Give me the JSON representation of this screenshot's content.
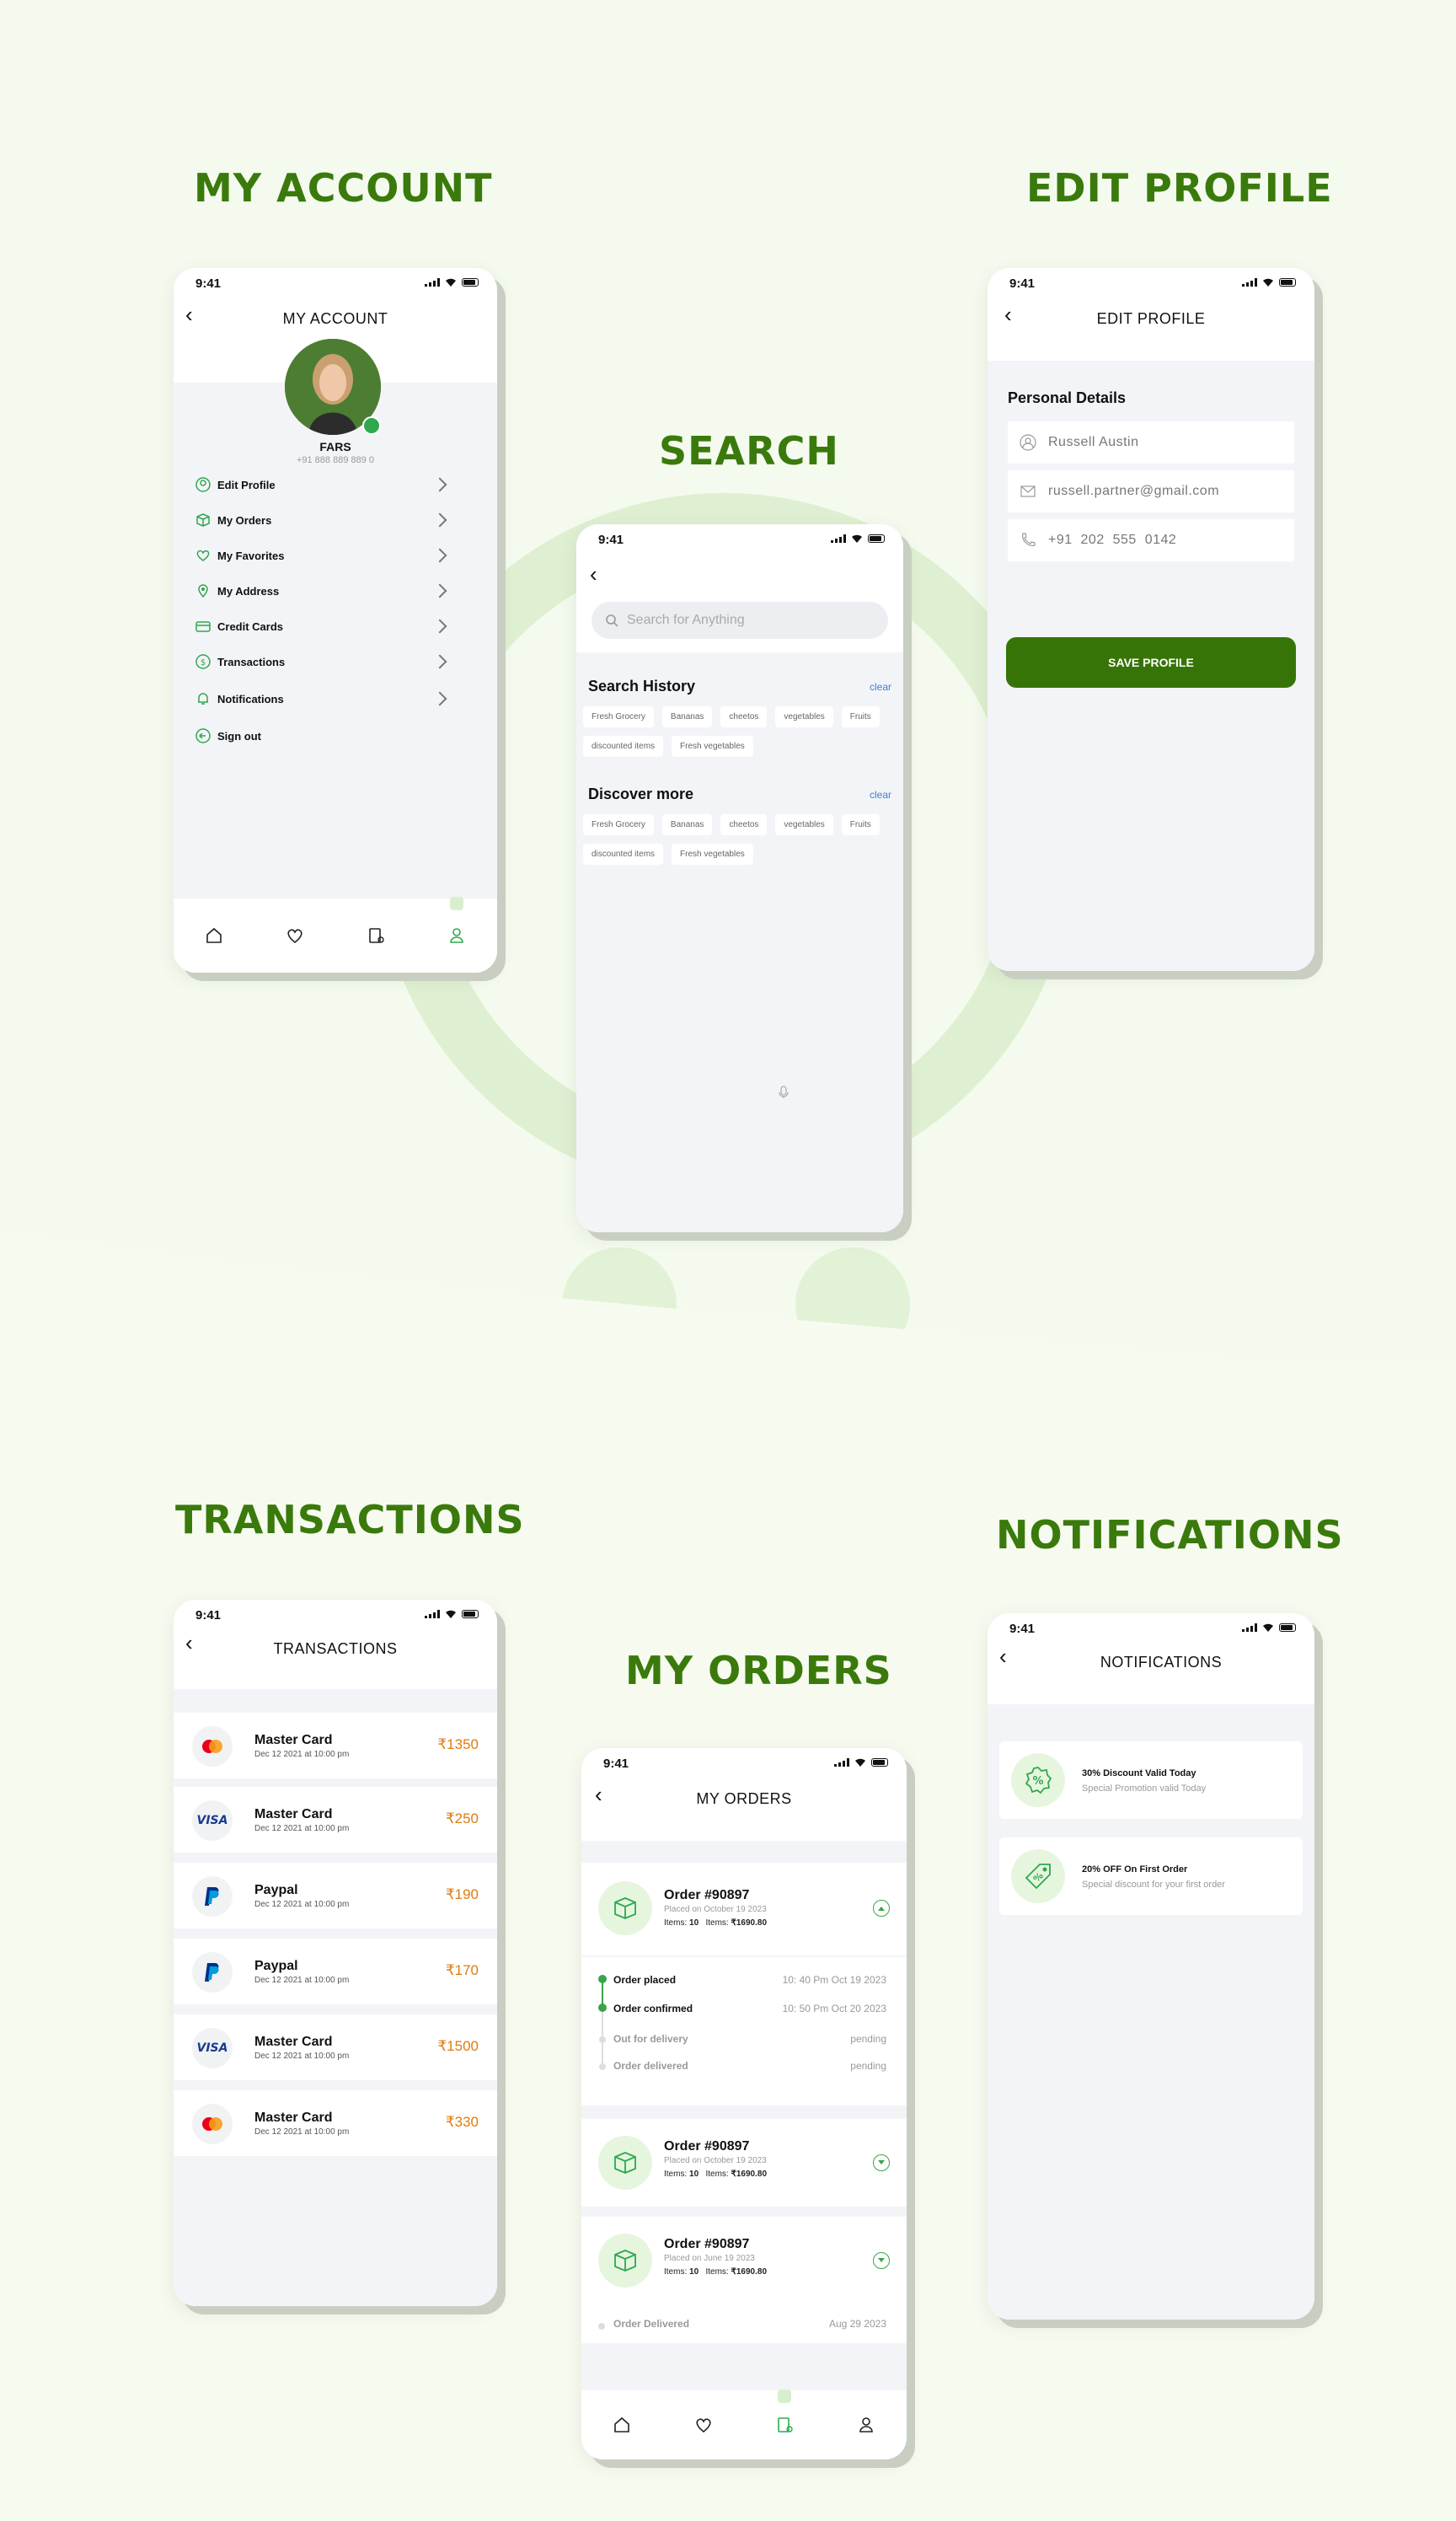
{
  "status_time": "9:41",
  "headings": {
    "account": "MY ACCOUNT",
    "edit": "EDIT PROFILE",
    "search": "SEARCH",
    "transactions": "TRANSACTIONS",
    "notifications": "NOTIFICATIONS",
    "orders": "MY ORDERS"
  },
  "account": {
    "title": "MY ACCOUNT",
    "name": "FARS",
    "phone": "+91 888 889 889 0",
    "menu": [
      {
        "label": "Edit Profile",
        "icon": "user-icon"
      },
      {
        "label": "My Orders",
        "icon": "box-icon"
      },
      {
        "label": "My Favorites",
        "icon": "heart-icon"
      },
      {
        "label": "My Address",
        "icon": "location-icon"
      },
      {
        "label": "Credit Cards",
        "icon": "credit-card-icon"
      },
      {
        "label": "Transactions",
        "icon": "transactions-icon"
      },
      {
        "label": "Notifications",
        "icon": "bell-icon"
      },
      {
        "label": "Sign out",
        "icon": "sign-out-icon"
      }
    ]
  },
  "search": {
    "placeholder": "Search for Anything",
    "history_title": "Search History",
    "discover_title": "Discover more",
    "clear_label": "clear",
    "history_chips": [
      "Fresh Grocery",
      "Bananas",
      "cheetos",
      "vegetables",
      "Fruits",
      "discounted items",
      "Fresh vegetables"
    ],
    "discover_chips": [
      "Fresh Grocery",
      "Bananas",
      "cheetos",
      "vegetables",
      "Fruits",
      "discounted items",
      "Fresh vegetables"
    ]
  },
  "edit_profile": {
    "title": "EDIT PROFILE",
    "section": "Personal Details",
    "name_value": "Russell Austin",
    "email_value": "russell.partner@gmail.com",
    "phone_value": "+91  202  555  0142",
    "save_label": "SAVE PROFILE"
  },
  "transactions": {
    "title": "TRANSACTIONS",
    "rows": [
      {
        "name": "Master Card",
        "date": "Dec 12 2021 at 10:00 pm",
        "amount": "₹1350",
        "logo": "mastercard"
      },
      {
        "name": "Master Card",
        "date": "Dec 12 2021 at 10:00 pm",
        "amount": "₹250",
        "logo": "visa"
      },
      {
        "name": "Paypal",
        "date": "Dec 12 2021 at 10:00 pm",
        "amount": "₹190",
        "logo": "paypal"
      },
      {
        "name": "Paypal",
        "date": "Dec 12 2021 at 10:00 pm",
        "amount": "₹170",
        "logo": "paypal"
      },
      {
        "name": "Master Card",
        "date": "Dec 12 2021 at 10:00 pm",
        "amount": "₹1500",
        "logo": "visa"
      },
      {
        "name": "Master Card",
        "date": "Dec 12 2021 at 10:00 pm",
        "amount": "₹330",
        "logo": "mastercard"
      }
    ],
    "visa_text": "VISA"
  },
  "orders": {
    "title": "MY ORDERS",
    "cards": [
      {
        "title": "Order #90897",
        "placed": "Placed on October 19 2023",
        "items_label": "Items:",
        "items_count": "10",
        "price_label": "Items:",
        "price": "₹1690.80"
      },
      {
        "title": "Order #90897",
        "placed": "Placed on October 19 2023",
        "items_label": "Items:",
        "items_count": "10",
        "price_label": "Items:",
        "price": "₹1690.80"
      },
      {
        "title": "Order #90897",
        "placed": "Placed on June 19 2023",
        "items_label": "Items:",
        "items_count": "10",
        "price_label": "Items:",
        "price": "₹1690.80"
      }
    ],
    "timeline": [
      {
        "label": "Order placed",
        "value": "10: 40 Pm Oct 19 2023"
      },
      {
        "label": "Order confirmed",
        "value": "10: 50 Pm Oct 20 2023"
      },
      {
        "label": "Out for delivery",
        "value": "pending"
      },
      {
        "label": "Order delivered",
        "value": "pending"
      }
    ],
    "delivered": {
      "label": "Order Delivered",
      "value": "Aug 29 2023"
    }
  },
  "notifications": {
    "title": "NOTIFICATIONS",
    "items": [
      {
        "title": "30% Discount Valid Today",
        "sub": "Special Promotion valid Today"
      },
      {
        "title": "20% OFF On First Order",
        "sub": "Special discount for your first order"
      }
    ]
  },
  "colors": {
    "accent": "#377408",
    "heading": "#3a7a0c",
    "amount": "#e07b0f",
    "link": "#3b82d6"
  }
}
